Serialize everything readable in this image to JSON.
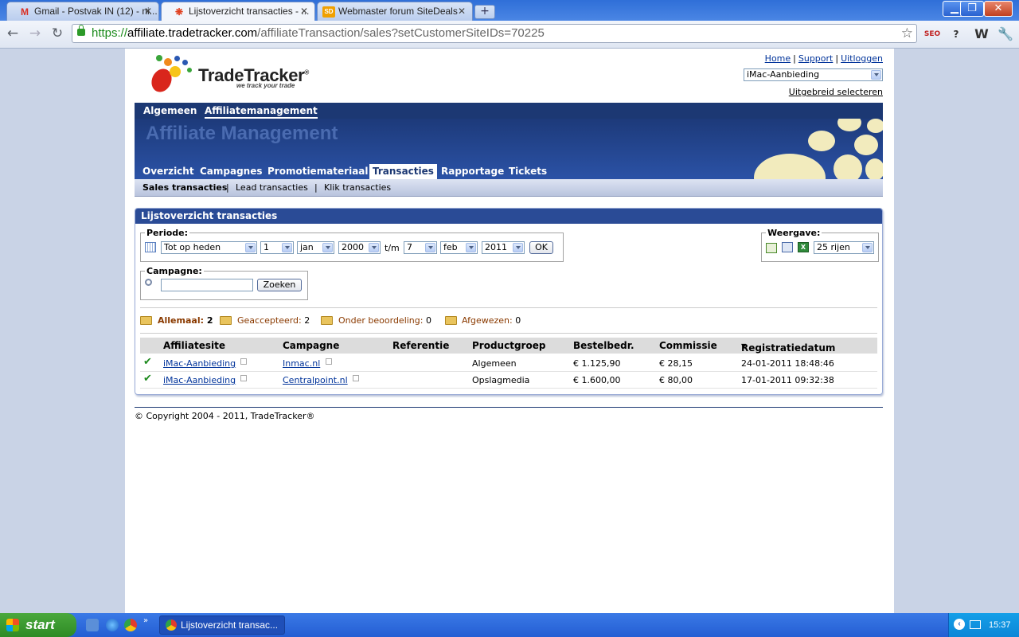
{
  "browser": {
    "tabs": [
      {
        "title": "Gmail - Postvak IN (12) - ni...",
        "icon": "gmail-icon",
        "active": false
      },
      {
        "title": "Lijstoverzicht transacties - ...",
        "icon": "tradetracker-favicon",
        "active": true
      },
      {
        "title": "Webmaster forum SiteDeals",
        "icon": "sitedeals-favicon",
        "active": false
      }
    ],
    "url_scheme": "https://",
    "url_host": "affiliate.tradetracker.com",
    "url_path": "/affiliateTransaction/sales?setCustomerSiteIDs=70225",
    "extensions": [
      "SEO",
      "?",
      "W"
    ]
  },
  "site": {
    "logo_text": "TradeTracker",
    "logo_reg": "®",
    "logo_tagline": "we track your trade",
    "top_links": [
      "Home",
      "Support",
      "Uitloggen"
    ],
    "site_select": "iMac-Aanbieding",
    "advanced_select": "Uitgebreid selecteren"
  },
  "main_nav": [
    "Algemeen",
    "Affiliatemanagement"
  ],
  "banner_title": "Affiliate Management",
  "section_tabs": [
    "Overzicht",
    "Campagnes",
    "Promotiemateriaal",
    "Transacties",
    "Rapportage",
    "Tickets"
  ],
  "sub_tabs": [
    "Sales transacties",
    "Lead transacties",
    "Klik transacties"
  ],
  "panel": {
    "title": "Lijstoverzicht transacties",
    "period_legend": "Periode:",
    "period_type": "Tot op heden",
    "from_day": "1",
    "from_month": "jan",
    "from_year": "2000",
    "tm_label": "t/m",
    "to_day": "7",
    "to_month": "feb",
    "to_year": "2011",
    "ok_label": "OK",
    "view_legend": "Weergave:",
    "rows_select": "25 rijen",
    "campaign_legend": "Campagne:",
    "search_label": "Zoeken"
  },
  "statuses": [
    {
      "label": "Allemaal:",
      "count": "2"
    },
    {
      "label": "Geaccepteerd:",
      "count": "2"
    },
    {
      "label": "Onder beoordeling:",
      "count": "0"
    },
    {
      "label": "Afgewezen:",
      "count": "0"
    }
  ],
  "table": {
    "headers": [
      "Affiliatesite",
      "Campagne",
      "Referentie",
      "Productgroep",
      "Bestelbedr.",
      "Commissie",
      "Registratiedatum"
    ],
    "rows": [
      {
        "site": "iMac-Aanbieding",
        "campaign": "Inmac.nl",
        "reference": "",
        "group": "Algemeen",
        "amount": "€ 1.125,90",
        "commission": "€ 28,15",
        "date": "24-01-2011 18:48:46"
      },
      {
        "site": "iMac-Aanbieding",
        "campaign": "Centralpoint.nl",
        "reference": "",
        "group": "Opslagmedia",
        "amount": "€ 1.600,00",
        "commission": "€ 80,00",
        "date": "17-01-2011 09:32:38"
      }
    ]
  },
  "footer": "© Copyright 2004 - 2011, TradeTracker®",
  "taskbar": {
    "start": "start",
    "task": "Lijstoverzicht transac...",
    "clock": "15:37"
  }
}
